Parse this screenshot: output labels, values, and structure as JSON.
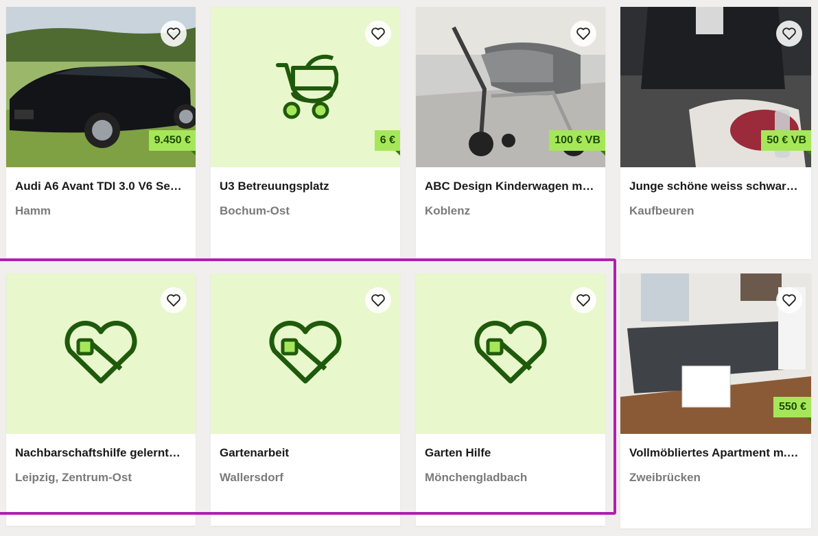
{
  "colors": {
    "placeholder_bg": "#e8f7cc",
    "price_badge_bg": "#a6e75a",
    "price_text": "#1d4b00",
    "icon_green": "#1f5a0c",
    "highlight": "#b01fb0"
  },
  "listings": [
    {
      "title": "Audi A6 Avant TDI 3.0 V6 Seh…",
      "location": "Hamm",
      "price": "9.450 €",
      "image": "car-photo"
    },
    {
      "title": "U3 Betreuungsplatz",
      "location": "Bochum-Ost",
      "price": "6 €",
      "image": "stroller-placeholder-icon"
    },
    {
      "title": "ABC Design Kinderwagen mi…",
      "location": "Koblenz",
      "price": "100 € VB",
      "image": "stroller-photo"
    },
    {
      "title": "Junge schöne weiss schwar…",
      "location": "Kaufbeuren",
      "price": "50 € VB",
      "image": "armchair-photo"
    },
    {
      "title": "Nachbarschaftshilfe gelernt…",
      "location": "Leipzig, Zentrum-Ost",
      "price": "",
      "image": "heart-tag-placeholder-icon"
    },
    {
      "title": "Gartenarbeit",
      "location": "Wallersdorf",
      "price": "",
      "image": "heart-tag-placeholder-icon"
    },
    {
      "title": "Garten Hilfe",
      "location": "Mönchengladbach",
      "price": "",
      "image": "heart-tag-placeholder-icon"
    },
    {
      "title": "Vollmöbliertes Apartment m.…",
      "location": "Zweibrücken",
      "price": "550 €",
      "image": "apartment-photo"
    }
  ]
}
